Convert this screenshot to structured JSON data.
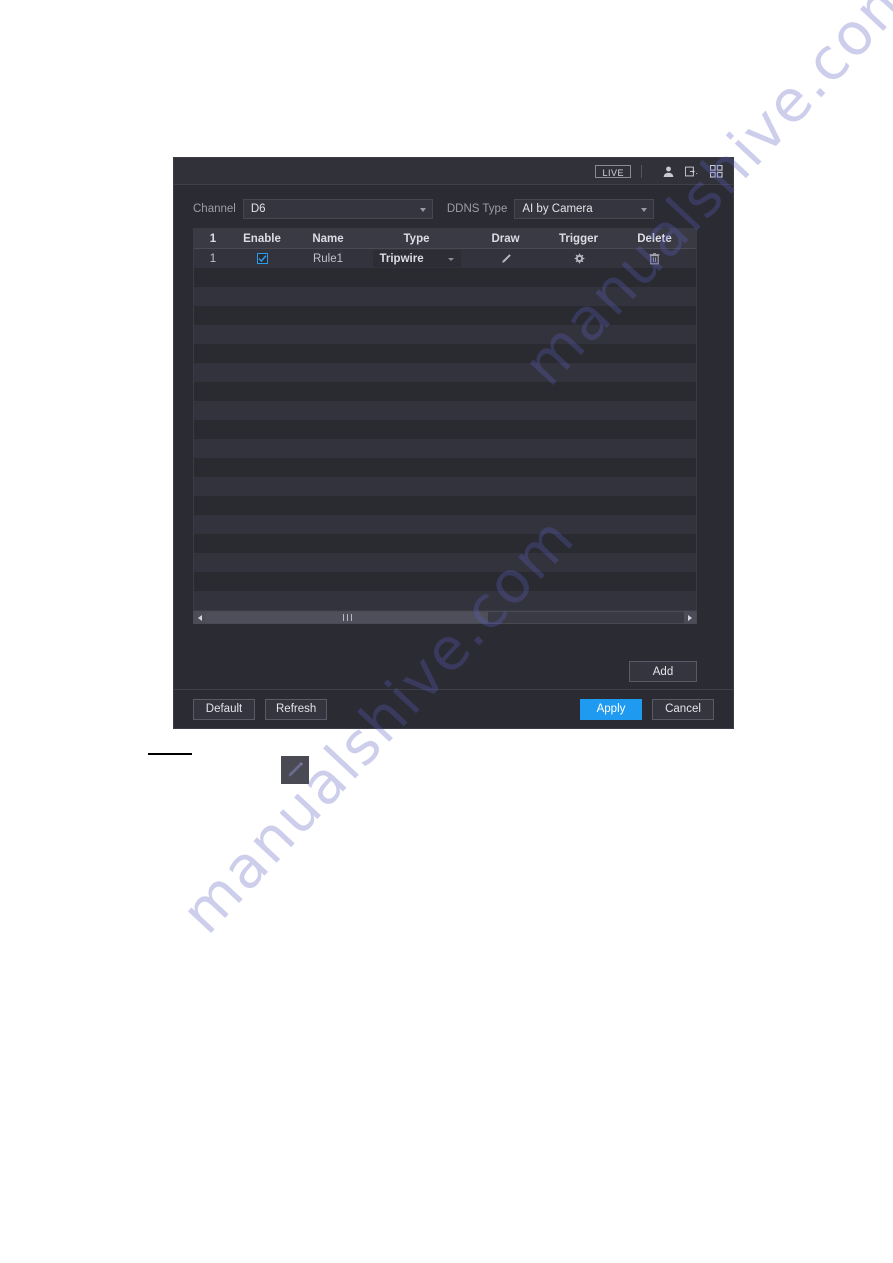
{
  "window": {
    "titlebar": {
      "live_label": "LIVE",
      "icons": [
        {
          "name": "user-icon"
        },
        {
          "name": "logout-icon"
        },
        {
          "name": "apps-grid-icon"
        }
      ]
    }
  },
  "filters": {
    "channel": {
      "label": "Channel",
      "value": "D6"
    },
    "ddns_type": {
      "label": "DDNS Type",
      "value": "AI by Camera"
    }
  },
  "table": {
    "headers": [
      "1",
      "Enable",
      "Name",
      "Type",
      "Draw",
      "Trigger",
      "Delete"
    ],
    "rows": [
      {
        "index": "1",
        "enabled": true,
        "name": "Rule1",
        "type": "Tripwire",
        "draw_icon": "pencil-icon",
        "trigger_icon": "gear-icon",
        "delete_icon": "trash-icon"
      }
    ],
    "empty_row_count": 18
  },
  "scrollbar": {
    "left_arrow": "scroll-left-arrow",
    "right_arrow": "scroll-right-arrow"
  },
  "buttons": {
    "add": "Add",
    "default": "Default",
    "refresh": "Refresh",
    "apply": "Apply",
    "cancel": "Cancel"
  },
  "annotations": {
    "edit_chip_icon": "pencil-icon"
  },
  "watermark": {
    "line1": "manualshive.com",
    "line2": "manualshive.com"
  },
  "colors": {
    "accent_blue": "#1e9bf0",
    "checkbox_blue": "#2b9de8",
    "window_bg": "#2b2b33",
    "header_row": "#3a3a45"
  }
}
